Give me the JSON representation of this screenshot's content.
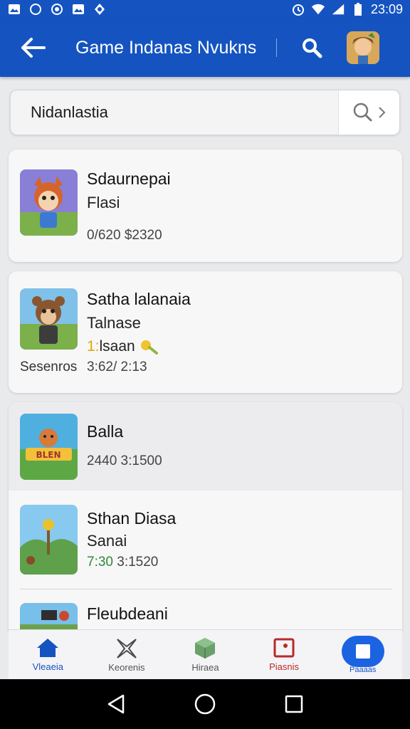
{
  "status_bar": {
    "time": "23:09",
    "icons": [
      "image-icon",
      "whatsapp-icon",
      "circle-icon",
      "image-icon",
      "notification-icon",
      "alarm-icon",
      "wifi-icon",
      "signal-icon",
      "battery-icon"
    ]
  },
  "app_bar": {
    "title": "Game Indanas Nvukns",
    "back_icon": "arrow-left-icon",
    "search_icon": "search-icon",
    "avatar": "avatar"
  },
  "search": {
    "value": "Nidanlastia",
    "icon": "search-icon"
  },
  "items": [
    {
      "title": "Sdaurnepai",
      "subtitle": "Flasi",
      "meta": "0/620 $2320"
    },
    {
      "title": "Satha lalanaia",
      "subtitle": "Talnase",
      "badge_prefix": "1:",
      "badge_text": "lsaan",
      "leading": "Sesenros",
      "meta": "3:62/ 2:13"
    },
    {
      "title": "Balla",
      "meta": "2440 3:1500"
    },
    {
      "title": "Sthan Diasa",
      "subtitle": "Sanai",
      "meta_green": "7:30",
      "meta": "3:1520"
    },
    {
      "title": "Fleubdeani"
    }
  ],
  "bottom_nav": [
    {
      "label": "Vleaeia",
      "icon": "home-icon"
    },
    {
      "label": "Keorenis",
      "icon": "star-icon"
    },
    {
      "label": "Hiraea",
      "icon": "cube-icon"
    },
    {
      "label": "Piasnis",
      "icon": "square-icon"
    },
    {
      "label": "Paaaas",
      "icon": "profile-icon"
    }
  ],
  "colors": {
    "primary": "#1554c0",
    "accent": "#1b63e0",
    "red": "#b72a2a",
    "green": "#2f8a36",
    "yellow": "#e0a800"
  }
}
